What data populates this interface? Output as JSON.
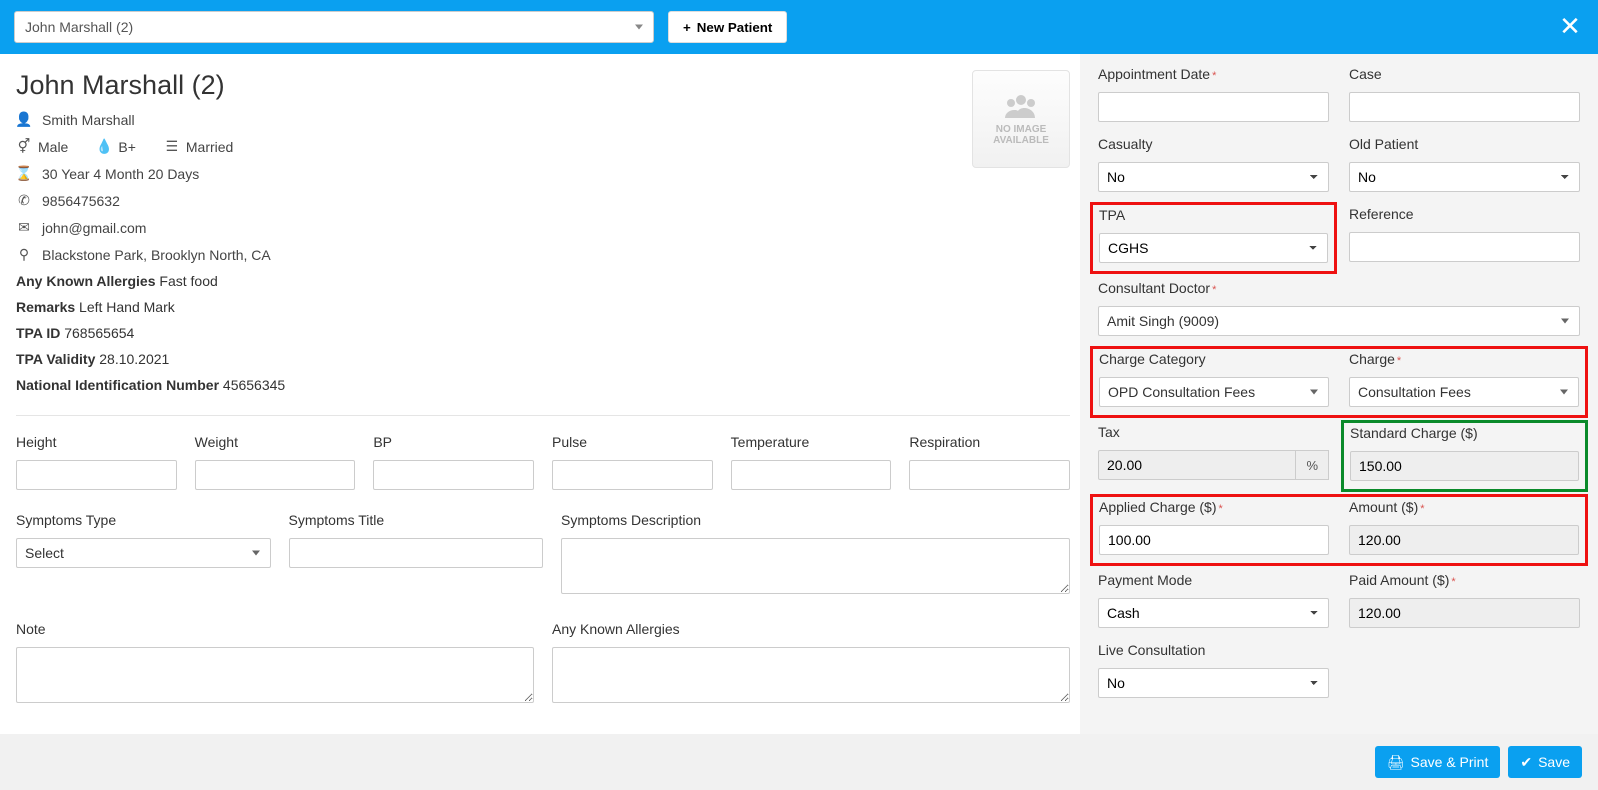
{
  "topbar": {
    "patient_select_value": "John Marshall (2)",
    "new_patient_label": "New Patient"
  },
  "patient": {
    "name": "John Marshall (2)",
    "guardian": "Smith Marshall",
    "gender": "Male",
    "blood": "B+",
    "marital": "Married",
    "age": "30 Year 4 Month 20 Days",
    "phone": "9856475632",
    "email": "john@gmail.com",
    "address": "Blackstone Park, Brooklyn North, CA",
    "allergies_label": "Any Known Allergies",
    "allergies_value": "Fast food",
    "remarks_label": "Remarks",
    "remarks_value": "Left Hand Mark",
    "tpa_id_label": "TPA ID",
    "tpa_id_value": "768565654",
    "tpa_validity_label": "TPA Validity",
    "tpa_validity_value": "28.10.2021",
    "nin_label": "National Identification Number",
    "nin_value": "45656345",
    "no_image_line1": "NO IMAGE",
    "no_image_line2": "AVAILABLE"
  },
  "vitals": {
    "height": "Height",
    "weight": "Weight",
    "bp": "BP",
    "pulse": "Pulse",
    "temperature": "Temperature",
    "respiration": "Respiration"
  },
  "symptoms": {
    "type_label": "Symptoms Type",
    "type_value": "Select",
    "title_label": "Symptoms Title",
    "desc_label": "Symptoms Description"
  },
  "notes": {
    "note_label": "Note",
    "allergies_label": "Any Known Allergies"
  },
  "form": {
    "appointment_date": "Appointment Date",
    "case": "Case",
    "casualty": "Casualty",
    "casualty_value": "No",
    "old_patient": "Old Patient",
    "old_patient_value": "No",
    "tpa": "TPA",
    "tpa_value": "CGHS",
    "reference": "Reference",
    "consultant": "Consultant Doctor",
    "consultant_value": "Amit Singh (9009)",
    "charge_category": "Charge Category",
    "charge_category_value": "OPD Consultation Fees",
    "charge": "Charge",
    "charge_value": "Consultation Fees",
    "tax": "Tax",
    "tax_value": "20.00",
    "tax_suffix": "%",
    "standard_charge": "Standard Charge ($)",
    "standard_charge_value": "150.00",
    "applied_charge": "Applied Charge ($)",
    "applied_charge_value": "100.00",
    "amount": "Amount ($)",
    "amount_value": "120.00",
    "payment_mode": "Payment Mode",
    "payment_mode_value": "Cash",
    "paid_amount": "Paid Amount ($)",
    "paid_amount_value": "120.00",
    "live_consultation": "Live Consultation",
    "live_consultation_value": "No"
  },
  "footer": {
    "save_print": "Save & Print",
    "save": "Save"
  }
}
